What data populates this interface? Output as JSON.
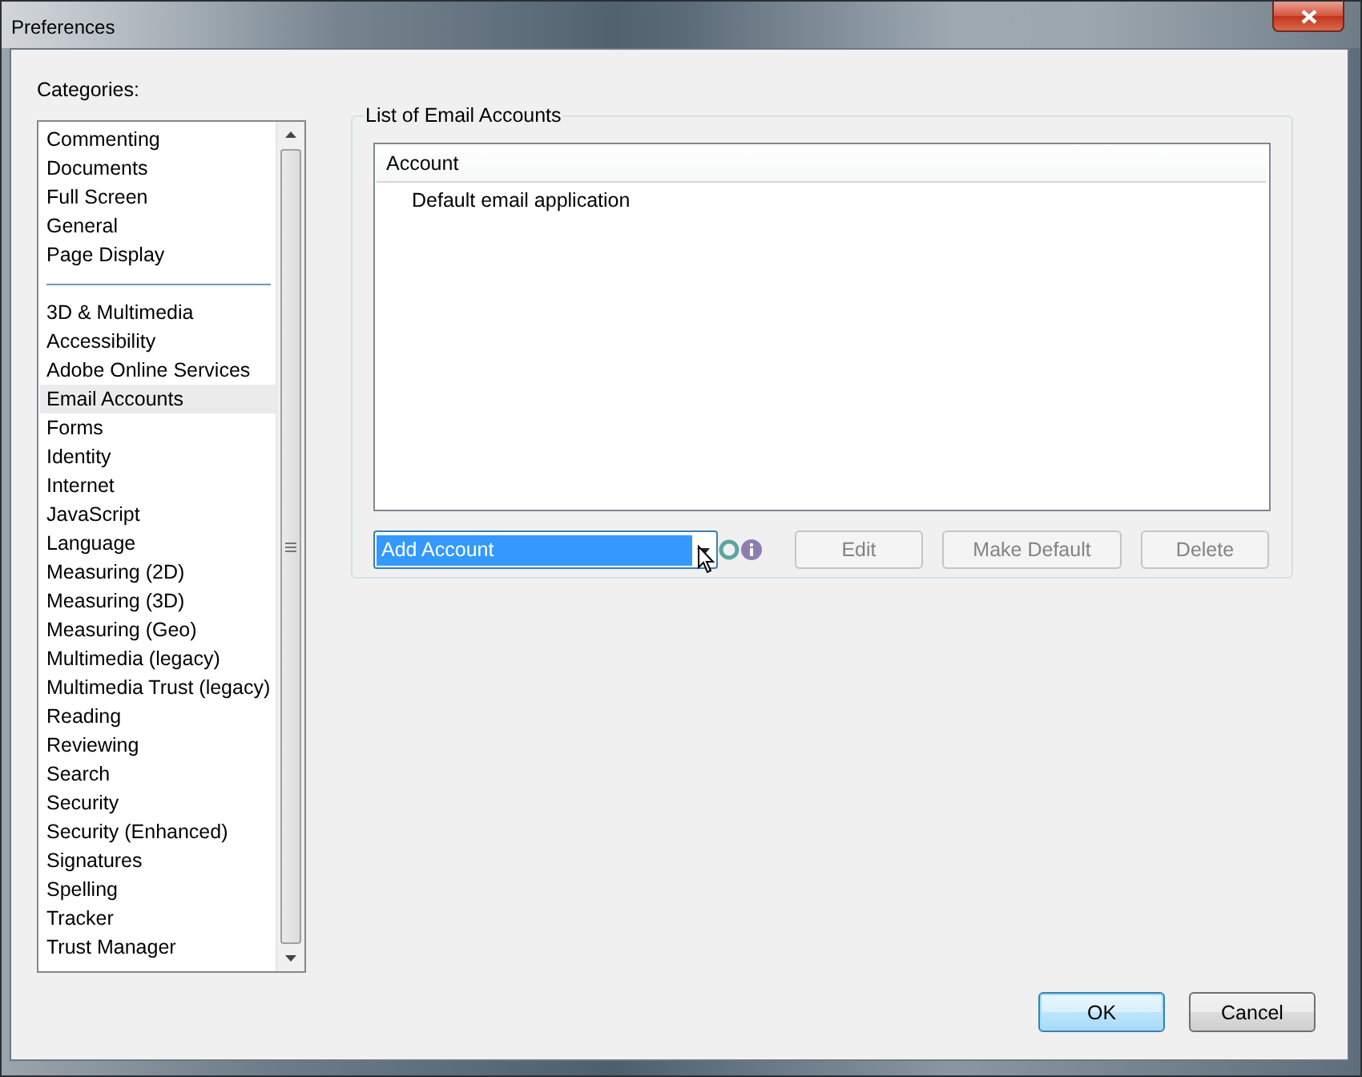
{
  "window": {
    "title": "Preferences"
  },
  "categories": {
    "label": "Categories:",
    "groups": [
      [
        {
          "label": "Commenting",
          "selected": false
        },
        {
          "label": "Documents",
          "selected": false
        },
        {
          "label": "Full Screen",
          "selected": false
        },
        {
          "label": "General",
          "selected": false
        },
        {
          "label": "Page Display",
          "selected": false
        }
      ],
      [
        {
          "label": "3D & Multimedia",
          "selected": false
        },
        {
          "label": "Accessibility",
          "selected": false
        },
        {
          "label": "Adobe Online Services",
          "selected": false
        },
        {
          "label": "Email Accounts",
          "selected": true
        },
        {
          "label": "Forms",
          "selected": false
        },
        {
          "label": "Identity",
          "selected": false
        },
        {
          "label": "Internet",
          "selected": false
        },
        {
          "label": "JavaScript",
          "selected": false
        },
        {
          "label": "Language",
          "selected": false
        },
        {
          "label": "Measuring (2D)",
          "selected": false
        },
        {
          "label": "Measuring (3D)",
          "selected": false
        },
        {
          "label": "Measuring (Geo)",
          "selected": false
        },
        {
          "label": "Multimedia (legacy)",
          "selected": false
        },
        {
          "label": "Multimedia Trust (legacy)",
          "selected": false
        },
        {
          "label": "Reading",
          "selected": false
        },
        {
          "label": "Reviewing",
          "selected": false
        },
        {
          "label": "Search",
          "selected": false
        },
        {
          "label": "Security",
          "selected": false
        },
        {
          "label": "Security (Enhanced)",
          "selected": false
        },
        {
          "label": "Signatures",
          "selected": false
        },
        {
          "label": "Spelling",
          "selected": false
        },
        {
          "label": "Tracker",
          "selected": false
        },
        {
          "label": "Trust Manager",
          "selected": false
        }
      ]
    ]
  },
  "email_accounts": {
    "title": "List of Email Accounts",
    "columns": [
      "Account"
    ],
    "rows": [
      "Default email application"
    ],
    "add_menu": {
      "value": "Add Account",
      "highlighted": true
    },
    "buttons": [
      {
        "label": "Edit",
        "disabled": true
      },
      {
        "label": "Make Default",
        "disabled": true
      },
      {
        "label": "Delete",
        "disabled": true
      }
    ]
  },
  "dialog_buttons": [
    {
      "label": "OK",
      "default": true
    },
    {
      "label": "Cancel",
      "default": false
    }
  ]
}
